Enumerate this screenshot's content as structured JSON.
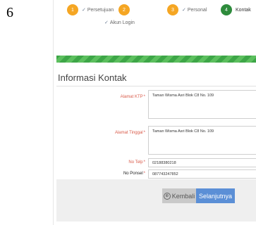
{
  "page_number": "6",
  "wizard": {
    "steps": [
      {
        "number": "1",
        "check": "✓",
        "label": "Persetujuan",
        "state": "done"
      },
      {
        "number": "2",
        "check": "✓",
        "label": "Akun Login",
        "state": "done"
      },
      {
        "number": "3",
        "check": "✓",
        "label": "Personal",
        "state": "done"
      },
      {
        "number": "4",
        "check": "",
        "label": "Kontak",
        "state": "active"
      }
    ]
  },
  "section": {
    "title": "Informasi Kontak"
  },
  "form": {
    "alamat_ktp": {
      "label": "Alamat KTP",
      "value": "Taman Wisma Asri Blok C8 No. 109"
    },
    "alamat_tinggal": {
      "label": "Alamat Tinggal",
      "value": "Taman Wisma Asri Blok C8 No. 109"
    },
    "no_telp": {
      "label": "No Telp",
      "value": "02188380218"
    },
    "no_ponsel": {
      "label": "No Ponsel",
      "value": "087743247852"
    },
    "required_mark": "*"
  },
  "buttons": {
    "back_label": "Kembali",
    "back_icon": "⊕",
    "next_label": "Selanjutnya"
  },
  "colors": {
    "step_pending": "#f5a623",
    "step_active": "#2e8b3c",
    "progress": "#3da647",
    "next_button": "#5b8fd6"
  }
}
